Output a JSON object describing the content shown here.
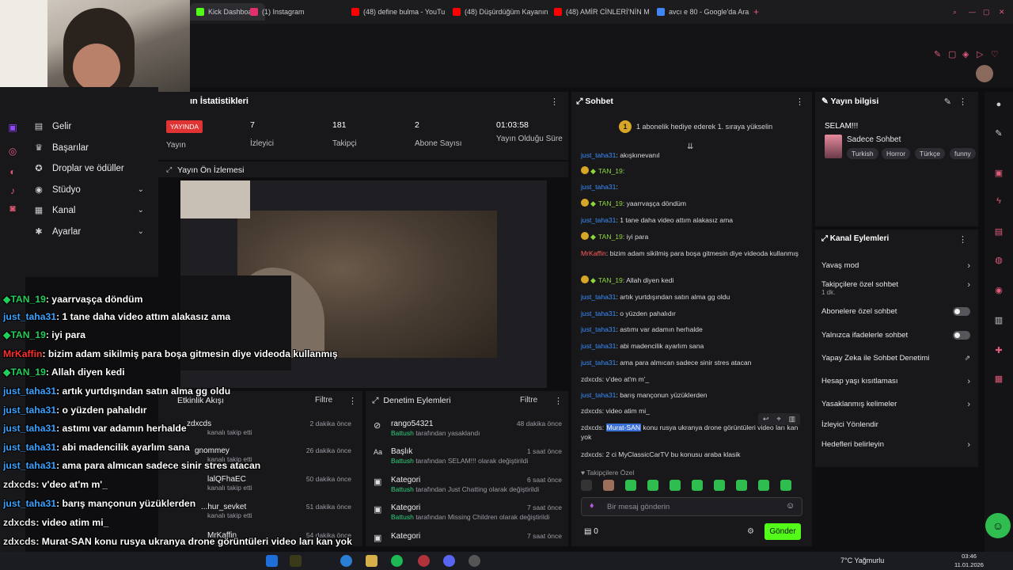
{
  "browser": {
    "tabs": [
      {
        "label": "Kick Dashboard",
        "color": "#53fc18"
      },
      {
        "label": "(1) Instagram",
        "color": "#e1306c"
      },
      {
        "label": "(48) define bulma - YouTu",
        "color": "#ff0000"
      },
      {
        "label": "(48) Düşürdüğüm Kayanın",
        "color": "#ff0000"
      },
      {
        "label": "(48) AMİR CİNLERİ'NİN M",
        "color": "#ff0000"
      },
      {
        "label": "avcı e 80 - Google'da Ara",
        "color": "#4285f4"
      }
    ],
    "new_tab": "+"
  },
  "nav": {
    "items": [
      {
        "label": "Gelir",
        "icon": "dollar-icon",
        "glyph": "▤",
        "chevron": false
      },
      {
        "label": "Başarılar",
        "icon": "trophy-icon",
        "glyph": "♛",
        "chevron": false
      },
      {
        "label": "Droplar ve ödüller",
        "icon": "gift-icon",
        "glyph": "✪",
        "chevron": false
      },
      {
        "label": "Stüdyo",
        "icon": "studio-icon",
        "glyph": "◉",
        "chevron": true
      },
      {
        "label": "Kanal",
        "icon": "channel-icon",
        "glyph": "▦",
        "chevron": true
      },
      {
        "label": "Ayarlar",
        "icon": "settings-icon",
        "glyph": "✱",
        "chevron": true
      }
    ]
  },
  "stats": {
    "title": "ın İstatistikleri",
    "live_badge": "YAYINDA",
    "items": [
      {
        "value": "",
        "label": "Yayın"
      },
      {
        "value": "7",
        "label": "İzleyici"
      },
      {
        "value": "181",
        "label": "Takipçi"
      },
      {
        "value": "2",
        "label": "Abone Sayısı"
      },
      {
        "value": "01:03:58",
        "label": "Yayın Olduğu Süre"
      }
    ]
  },
  "preview": {
    "title": "Yayın Ön İzlemesi"
  },
  "overlay_chat": [
    {
      "user": "TAN_19",
      "text": ": yaarrvaşça döndüm",
      "color": "g",
      "badge": true
    },
    {
      "user": "just_taha31",
      "text": ": 1 tane daha video attım alakasız ama",
      "color": "b",
      "badge": false
    },
    {
      "user": "TAN_19",
      "text": ": iyi para",
      "color": "g",
      "badge": true
    },
    {
      "user": "MrKaffin",
      "text": ": bizim adam sikilmiş para boşa gitmesin diye videoda kullanmış",
      "color": "r",
      "badge": false
    },
    {
      "user": "TAN_19",
      "text": ": Allah diyen kedi",
      "color": "g",
      "badge": true
    },
    {
      "user": "just_taha31",
      "text": ": artık yurtdışından satın alma gg oldu",
      "color": "b",
      "badge": false
    },
    {
      "user": "just_taha31",
      "text": ": o yüzden pahalıdır",
      "color": "b",
      "badge": false
    },
    {
      "user": "just_taha31",
      "text": ": astımı var adamın herhalde",
      "color": "b",
      "badge": false
    },
    {
      "user": "just_taha31",
      "text": ": abi madencilik ayarlım sana",
      "color": "b",
      "badge": false
    },
    {
      "user": "just_taha31",
      "text": ": ama para almıcan sadece sinir stres atacan",
      "color": "b",
      "badge": false
    },
    {
      "user": "zdxcds",
      "text": ": v'deo at'm m'_",
      "color": "w",
      "badge": false
    },
    {
      "user": "just_taha31",
      "text": ": barış mançonun yüzüklerden",
      "color": "b",
      "badge": false
    },
    {
      "user": "zdxcds",
      "text": ": video atim mi_",
      "color": "w",
      "badge": false
    },
    {
      "user": "zdxcds",
      "text": ": Murat-SAN konu rusya ukranya drone görüntüleri video ları kan yok",
      "color": "w",
      "badge": false
    },
    {
      "user": "zdxcds",
      "text": ": 2 ci MyClassicCarTV bu konusu araba klasik",
      "color": "w",
      "badge": false
    }
  ],
  "activity": {
    "title": "Etkinlik Akışı",
    "filter": "Filtre",
    "rows": [
      {
        "name": "zdxcds",
        "sub": "kanalı takip etti",
        "time": "2 dakika önce"
      },
      {
        "name": "gnommey",
        "sub": "kanalı takip etti",
        "time": "26 dakika önce"
      },
      {
        "name": "lalQFhaEC",
        "sub": "kanalı takip etti",
        "time": "50 dakika önce"
      },
      {
        "name": "...hur_sevket",
        "sub": "kanalı takip etti",
        "time": "51 dakika önce"
      },
      {
        "name": "MrKaffin",
        "sub": "",
        "time": "54 dakika önce"
      }
    ]
  },
  "modlog": {
    "title": "Denetim Eylemleri",
    "filter": "Filtre",
    "rows": [
      {
        "name": "rango54321",
        "actor": "Battush",
        "text": " tarafından yasaklandı",
        "time": "48 dakika önce",
        "icon": "ban-icon",
        "glyph": "⊘"
      },
      {
        "name": "Başlık",
        "actor": "Battush",
        "text": " tarafından SELAM!!! olarak değiştirildi",
        "time": "1 saat önce",
        "icon": "title-icon",
        "glyph": "Aa"
      },
      {
        "name": "Kategori",
        "actor": "Battush",
        "text": " tarafından Just Chatting olarak değiştirildi",
        "time": "6 saat önce",
        "icon": "category-icon",
        "glyph": "▣"
      },
      {
        "name": "Kategori",
        "actor": "Battush",
        "text": " tarafından Missing Children olarak değiştirildi",
        "time": "7 saat önce",
        "icon": "category-icon",
        "glyph": "▣"
      },
      {
        "name": "Kategori",
        "actor": "",
        "text": "",
        "time": "7 saat önce",
        "icon": "category-icon",
        "glyph": "▣"
      }
    ]
  },
  "chat": {
    "title": "Sohbet",
    "notice": "1 abonelik hediye ederek 1. sıraya yükselin",
    "notice_badge": "1",
    "messages": [
      {
        "user": "just_taha31",
        "text": ": akışkınevanıl",
        "color": "b",
        "badge": false
      },
      {
        "user": "TAN_19",
        "text": ":",
        "color": "g",
        "badge": true
      },
      {
        "user": "just_taha31",
        "text": ":",
        "color": "b",
        "badge": false
      },
      {
        "user": "TAN_19",
        "text": ": yaarrvaşça döndüm",
        "color": "g",
        "badge": true
      },
      {
        "user": "just_taha31",
        "text": ": 1 tane daha video attım alakasız ama",
        "color": "b",
        "badge": false
      },
      {
        "user": "TAN_19",
        "text": ": iyi para",
        "color": "g",
        "badge": true
      },
      {
        "user": "MrKaffin",
        "text": ": bizim adam sikilmiş para boşa gitmesin diye videoda kullanmış",
        "color": "r",
        "badge": false
      },
      {
        "user": "TAN_19",
        "text": ": Allah diyen kedi",
        "color": "g",
        "badge": true
      },
      {
        "user": "just_taha31",
        "text": ": artık yurtdışından satın alma gg oldu",
        "color": "b",
        "badge": false
      },
      {
        "user": "just_taha31",
        "text": ": o yüzden pahalıdır",
        "color": "b",
        "badge": false
      },
      {
        "user": "just_taha31",
        "text": ": astımı var adamın herhalde",
        "color": "b",
        "badge": false
      },
      {
        "user": "just_taha31",
        "text": ": abi madencilik ayarlım sana",
        "color": "b",
        "badge": false
      },
      {
        "user": "just_taha31",
        "text": ": ama para almıcan sadece sinir stres atacan",
        "color": "b",
        "badge": false
      },
      {
        "user": "zdxcds",
        "text": ": v'deo at'm m'_",
        "color": "y",
        "badge": false
      },
      {
        "user": "just_taha31",
        "text": ": barış mançonun yüzüklerden",
        "color": "b",
        "badge": false
      },
      {
        "user": "zdxcds",
        "text": ": video atim mi_",
        "color": "y",
        "badge": false
      },
      {
        "user": "zdxcds",
        "text": ": Murat-SAN konu rusya ukranya drone görüntüleri video ları kan yok",
        "color": "y",
        "badge": false
      },
      {
        "user": "zdxcds",
        "text": ": 2 ci MyClassicCarTV bu konusu araba klasik",
        "color": "y",
        "badge": false
      }
    ],
    "followers_only": "♥ Takipçilere Özel",
    "placeholder": "Bir mesaj gönderin",
    "points": "0",
    "send": "Gönder"
  },
  "info": {
    "title": "Yayın bilgisi",
    "stream_title": "SELAM!!!",
    "category": "Sadece Sohbet",
    "tags": [
      "Turkish",
      "Horror",
      "Türkçe",
      "funny"
    ]
  },
  "channel_actions": {
    "title": "Kanal Eylemleri",
    "rows": [
      {
        "label": "Yavaş mod",
        "sub": "",
        "control": "arrow"
      },
      {
        "label": "Takipçilere özel sohbet",
        "sub": "1 dk.",
        "control": "arrow"
      },
      {
        "label": "Abonelere özel sohbet",
        "sub": "",
        "control": "toggle"
      },
      {
        "label": "Yalnızca ifadelerle sohbet",
        "sub": "",
        "control": "toggle"
      },
      {
        "label": "Yapay Zeka ile Sohbet Denetimi",
        "sub": "",
        "control": "external"
      },
      {
        "label": "Hesap yaşı kısıtlaması",
        "sub": "",
        "control": "arrow"
      },
      {
        "label": "Yasaklanmış kelimeler",
        "sub": "",
        "control": "arrow"
      },
      {
        "label": "İzleyici Yönlendir",
        "sub": "",
        "control": "none"
      },
      {
        "label": "Hedefleri belirleyin",
        "sub": "",
        "control": "arrow"
      }
    ]
  },
  "taskbar": {
    "weather": "7°C  Yağmurlu",
    "time": "03:46",
    "date": "11.01.2026"
  }
}
